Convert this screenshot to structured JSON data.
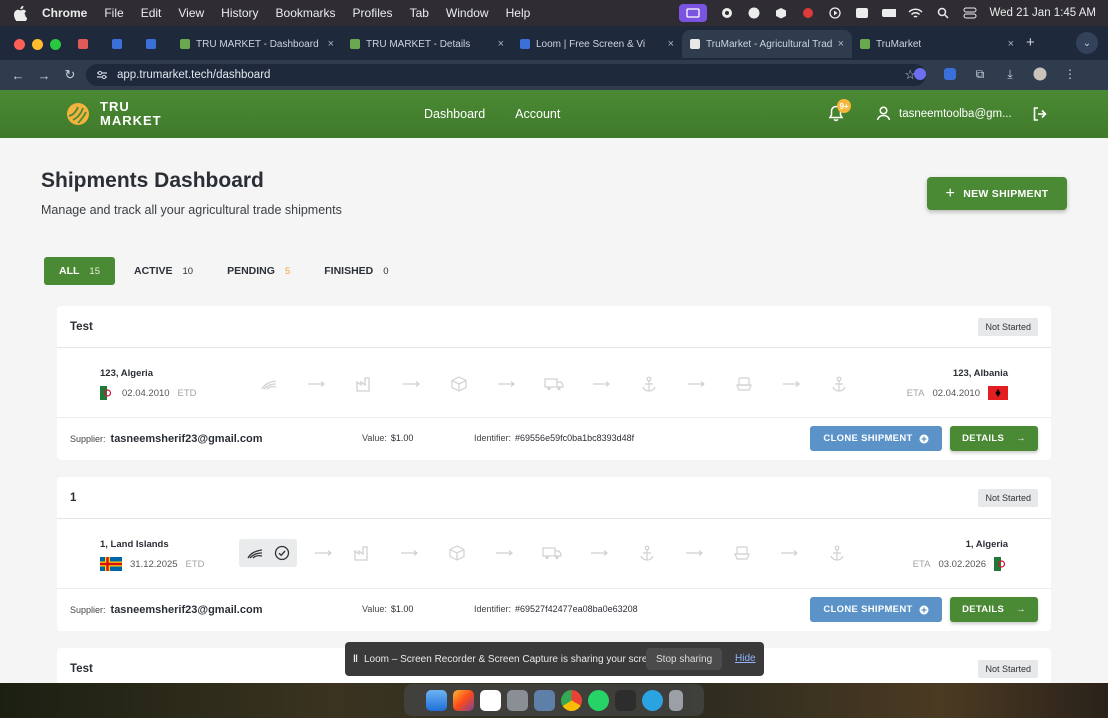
{
  "menubar": {
    "items": [
      "Chrome",
      "File",
      "Edit",
      "View",
      "History",
      "Bookmarks",
      "Profiles",
      "Tab",
      "Window",
      "Help"
    ],
    "clock": "Wed 21 Jan  1:45 AM"
  },
  "browser": {
    "tabs": [
      {
        "title": "",
        "color": "#e05a5a"
      },
      {
        "title": "",
        "color": "#3b6fd9"
      },
      {
        "title": "",
        "color": "#3b6fd9"
      },
      {
        "title": "TRU MARKET - Dashboard",
        "color": "#6aa84f"
      },
      {
        "title": "TRU MARKET - Details",
        "color": "#6aa84f"
      },
      {
        "title": "Loom | Free Screen & Vi",
        "color": "#3b6fd9"
      },
      {
        "title": "TruMarket - Agricultural Trad",
        "color": "#e8e8e8",
        "active": true
      },
      {
        "title": "TruMarket",
        "color": "#6aa84f"
      }
    ],
    "url": "app.trumarket.tech/dashboard"
  },
  "header": {
    "logo_line1": "TRU",
    "logo_line2": "MARKET",
    "nav": [
      "Dashboard",
      "Account"
    ],
    "notification_badge": "9+",
    "user_email": "tasneemtoolba@gm..."
  },
  "page": {
    "title": "Shipments Dashboard",
    "subtitle": "Manage and track all your agricultural trade shipments",
    "new_shipment_label": "NEW SHIPMENT"
  },
  "filters": [
    {
      "label": "ALL",
      "count": "15"
    },
    {
      "label": "ACTIVE",
      "count": "10"
    },
    {
      "label": "PENDING",
      "count": "5"
    },
    {
      "label": "FINISHED",
      "count": "0"
    }
  ],
  "shipments": [
    {
      "name": "Test",
      "status": "Not Started",
      "origin": "123, Algeria",
      "origin_date": "02.04.2010",
      "etd_label": "ETD",
      "destination": "123, Albania",
      "destination_date": "02.04.2010",
      "eta_label": "ETA",
      "supplier_label": "Supplier:",
      "supplier": "tasneemsherif23@gmail.com",
      "value_label": "Value:",
      "value": "$1.00",
      "identifier_label": "Identifier:",
      "identifier": "#69556e59fc0ba1bc8393d48f",
      "clone_label": "CLONE SHIPMENT",
      "details_label": "DETAILS"
    },
    {
      "name": "1",
      "status": "Not Started",
      "origin": "1, Land Islands",
      "origin_date": "31.12.2025",
      "etd_label": "ETD",
      "destination": "1, Algeria",
      "destination_date": "03.02.2026",
      "eta_label": "ETA",
      "supplier_label": "Supplier:",
      "supplier": "tasneemsherif23@gmail.com",
      "value_label": "Value:",
      "value": "$1.00",
      "identifier_label": "Identifier:",
      "identifier": "#69527f42477ea08ba0e63208",
      "clone_label": "CLONE SHIPMENT",
      "details_label": "DETAILS"
    },
    {
      "name": "Test",
      "status": "Not Started"
    }
  ],
  "loom": {
    "message": "Loom – Screen Recorder & Screen Capture is sharing your screen.",
    "stop_label": "Stop sharing",
    "hide_label": "Hide"
  },
  "colors": {
    "brand_green": "#4b8a34",
    "clone_blue": "#5b93c8",
    "pending_orange": "#f2a53b"
  }
}
